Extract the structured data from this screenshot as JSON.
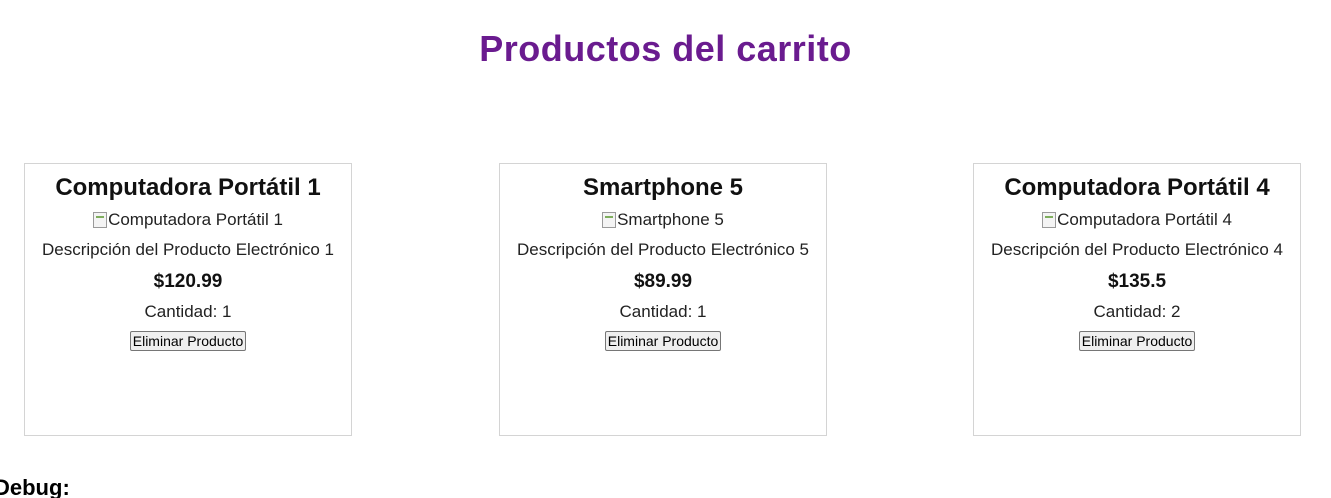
{
  "page": {
    "title": "Productos del carrito",
    "debug_label": "Debug:"
  },
  "products": [
    {
      "name": "Computadora Portátil 1",
      "image_alt": "Computadora Portátil 1",
      "description": "Descripción del Producto Electrónico 1",
      "price": "$120.99",
      "quantity": "Cantidad: 1",
      "remove_label": "Eliminar Producto"
    },
    {
      "name": "Smartphone 5",
      "image_alt": "Smartphone 5",
      "description": "Descripción del Producto Electrónico 5",
      "price": "$89.99",
      "quantity": "Cantidad: 1",
      "remove_label": "Eliminar Producto"
    },
    {
      "name": "Computadora Portátil 4",
      "image_alt": "Computadora Portátil 4",
      "description": "Descripción del Producto Electrónico 4",
      "price": "$135.5",
      "quantity": "Cantidad: 2",
      "remove_label": "Eliminar Producto"
    }
  ],
  "colors": {
    "title": "#6a1b8f",
    "card_border": "#d4d4d4",
    "background": "#ffffff"
  },
  "icons": {
    "broken_image": "broken-image-icon"
  }
}
